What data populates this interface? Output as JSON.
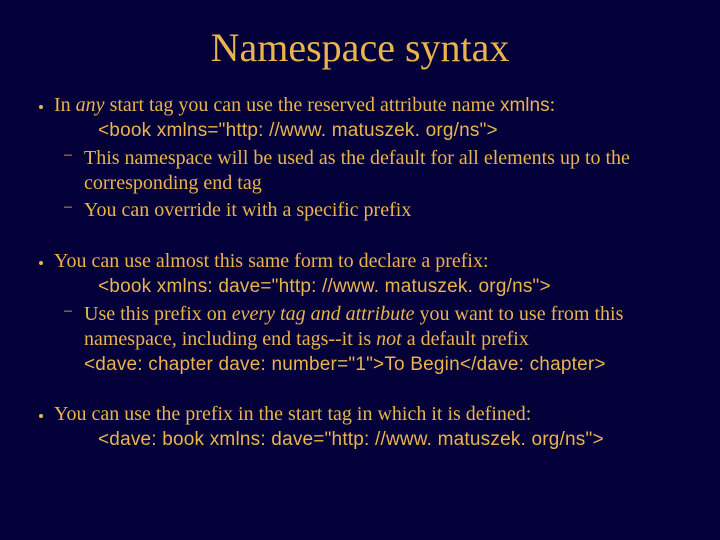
{
  "slide": {
    "title": "Namespace syntax",
    "b1": {
      "text_pre": "In ",
      "text_em": "any",
      "text_mid": " start tag you can use the reserved attribute name ",
      "text_mono": "xmlns",
      "text_post": ":",
      "code": "<book xmlns=\"http: //www. matuszek. org/ns\">",
      "sub1": "This namespace will be used as the default for all elements up to the corresponding end tag",
      "sub2": "You can override it with a specific prefix"
    },
    "b2": {
      "text": "You can use almost this same form to declare a prefix:",
      "code1": "<book xmlns: dave=\"http: //www. matuszek. org/ns\">",
      "sub1_pre": "Use this prefix on ",
      "sub1_em": "every tag and attribute",
      "sub1_mid": " you want to use from this namespace, including end tags--it is ",
      "sub1_em2": "not",
      "sub1_post": " a default prefix",
      "code2": "<dave: chapter dave: number=\"1\">To Begin</dave: chapter>"
    },
    "b3": {
      "text": "You can use the prefix in the start tag in which it is defined:",
      "code": "<dave: book xmlns: dave=\"http: //www. matuszek. org/ns\">"
    }
  }
}
